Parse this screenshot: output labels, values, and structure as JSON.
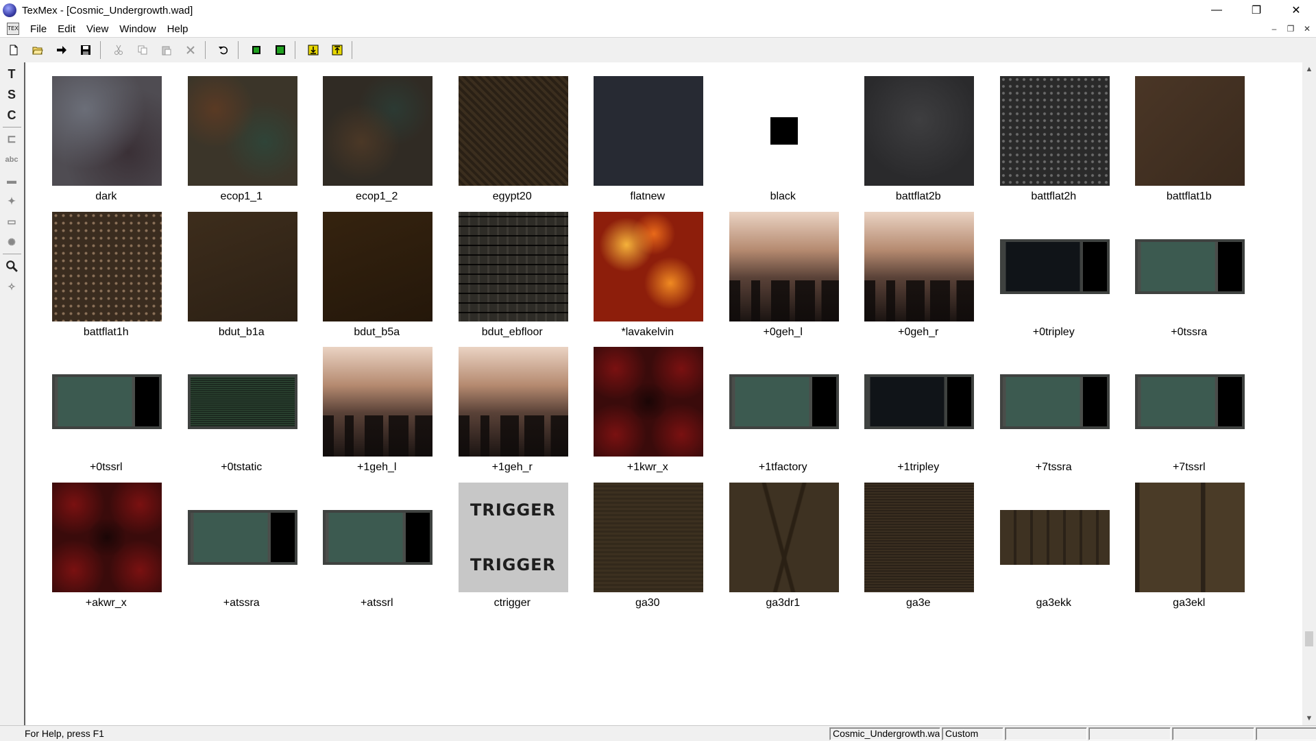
{
  "window": {
    "title": "TexMex - [Cosmic_Undergrowth.wad]",
    "minimize_glyph": "—",
    "restore_glyph": "❐",
    "close_glyph": "✕"
  },
  "menu": {
    "mdi_icon_text": "TEX",
    "items": [
      "File",
      "Edit",
      "View",
      "Window",
      "Help"
    ],
    "mdi_minimize": "–",
    "mdi_restore": "❐",
    "mdi_close": "✕"
  },
  "toolbar": {
    "icons": [
      "new-file-icon",
      "open-folder-icon",
      "import-arrow-icon",
      "save-icon",
      "cut-icon",
      "copy-icon",
      "paste-icon",
      "delete-icon",
      "undo-icon",
      "resize-green-icon",
      "fit-green-icon",
      "export-yellow-icon",
      "import-yellow-icon"
    ]
  },
  "left_tools": {
    "icons": [
      "text-tool-icon",
      "s-tool-icon",
      "c-tool-icon",
      "crop-icon",
      "spell-icon",
      "bubble-icon",
      "stamp-icon",
      "brush-icon",
      "sparkle-icon",
      "zoom-icon",
      "walk-icon"
    ],
    "labels": [
      "T",
      "S",
      "C",
      "⊏",
      "abc",
      "▬",
      "✦",
      "▭",
      "✺",
      "🔍",
      "✧"
    ]
  },
  "textures": [
    {
      "name": "dark",
      "style": "t-dark",
      "shape": "full"
    },
    {
      "name": "ecop1_1",
      "style": "t-ecop1_1",
      "shape": "full"
    },
    {
      "name": "ecop1_2",
      "style": "t-ecop1_2",
      "shape": "full"
    },
    {
      "name": "egypt20",
      "style": "t-egypt20",
      "shape": "full"
    },
    {
      "name": "flatnew",
      "style": "t-flatnew",
      "shape": "full"
    },
    {
      "name": "black",
      "style": "t-black",
      "shape": "tiny"
    },
    {
      "name": "battflat2b",
      "style": "t-battflat2b",
      "shape": "full"
    },
    {
      "name": "battflat2h",
      "style": "t-battflat2h",
      "shape": "full"
    },
    {
      "name": "battflat1b",
      "style": "t-battflat1b",
      "shape": "full"
    },
    {
      "name": "battflat1h",
      "style": "t-battflat1h",
      "shape": "full"
    },
    {
      "name": "bdut_b1a",
      "style": "t-bdut_b1a",
      "shape": "full"
    },
    {
      "name": "bdut_b5a",
      "style": "t-bdut_b5a",
      "shape": "full"
    },
    {
      "name": "bdut_ebfloor",
      "style": "t-bdut_ebfloor",
      "shape": "full"
    },
    {
      "name": "*lavakelvin",
      "style": "t-lavakelvin",
      "shape": "full"
    },
    {
      "name": "+0geh_l",
      "style": "t-sky",
      "shape": "full"
    },
    {
      "name": "+0geh_r",
      "style": "t-sky",
      "shape": "full"
    },
    {
      "name": "+0tripley",
      "style": "t-screen-text",
      "shape": "half"
    },
    {
      "name": "+0tssra",
      "style": "t-screen",
      "shape": "half"
    },
    {
      "name": "+0tssrl",
      "style": "t-screen",
      "shape": "half"
    },
    {
      "name": "+0tstatic",
      "style": "t-static",
      "shape": "half"
    },
    {
      "name": "+1geh_l",
      "style": "t-sky",
      "shape": "full"
    },
    {
      "name": "+1geh_r",
      "style": "t-sky",
      "shape": "full"
    },
    {
      "name": "+1kwr_x",
      "style": "t-kwr",
      "shape": "full"
    },
    {
      "name": "+1tfactory",
      "style": "t-screen",
      "shape": "half"
    },
    {
      "name": "+1tripley",
      "style": "t-screen-text",
      "shape": "half"
    },
    {
      "name": "+7tssra",
      "style": "t-screen",
      "shape": "half"
    },
    {
      "name": "+7tssrl",
      "style": "t-screen",
      "shape": "half"
    },
    {
      "name": "+akwr_x",
      "style": "t-kwr",
      "shape": "full"
    },
    {
      "name": "+atssra",
      "style": "t-screen",
      "shape": "half"
    },
    {
      "name": "+atssrl",
      "style": "t-screen",
      "shape": "half"
    },
    {
      "name": "ctrigger",
      "style": "t-trigger",
      "shape": "full",
      "overlay": [
        "TRIGGER",
        "TRIGGER"
      ]
    },
    {
      "name": "ga30",
      "style": "t-ga",
      "shape": "full"
    },
    {
      "name": "ga3dr1",
      "style": "t-ga3dr1",
      "shape": "full"
    },
    {
      "name": "ga3e",
      "style": "t-ga3e",
      "shape": "full"
    },
    {
      "name": "ga3ekk",
      "style": "t-ga3ekk",
      "shape": "half"
    },
    {
      "name": "ga3ekl",
      "style": "t-ga3ekl",
      "shape": "full"
    }
  ],
  "statusbar": {
    "help": "For Help, press F1",
    "panes": [
      "Cosmic_Undergrowth.wad",
      "Custom",
      "",
      "",
      "",
      "",
      ""
    ]
  },
  "scroll": {
    "up": "▲",
    "down": "▼",
    "position_fraction": 0.9
  }
}
